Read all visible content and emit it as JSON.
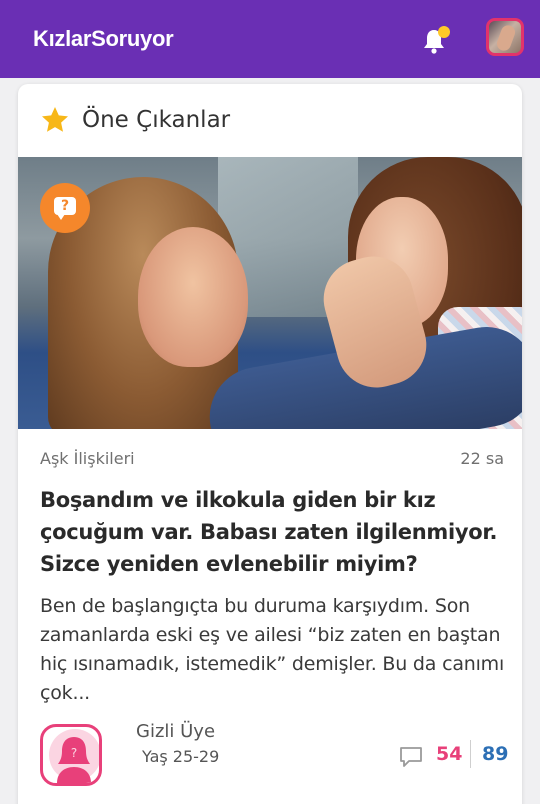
{
  "header": {
    "logo_text": "KızlarSoruyor",
    "notification_icon": "bell-icon",
    "notification_dot_color": "#ffc928",
    "bar_color": "#6a2fb4"
  },
  "featured": {
    "section_title": "Öne Çıkanlar",
    "section_icon": "star-icon",
    "post": {
      "type_badge_icon": "question-bubble-icon",
      "category": "Aşk İlişkileri",
      "time": "22 sa",
      "title": "Boşandım ve ilkokula giden bir kız çocuğum var. Babası zaten ilgilenmiyor. Sizce yeniden evlenebilir miyim?",
      "excerpt": "Ben de başlangıçta bu duruma karşıydım. Son zamanlarda eski eş ve ailesi “biz zaten en baştan hiç ısınamadık, istemedik” demişler. Bu da canımı çok...",
      "author": {
        "name": "Gizli Üye",
        "age": "Yaş 25-29"
      },
      "stats": {
        "comments": "54",
        "views": "89"
      }
    }
  },
  "colors": {
    "accent_pink": "#e8407a",
    "accent_blue": "#2c6fb5",
    "badge_orange": "#f5872b",
    "star_yellow": "#f7b718"
  }
}
